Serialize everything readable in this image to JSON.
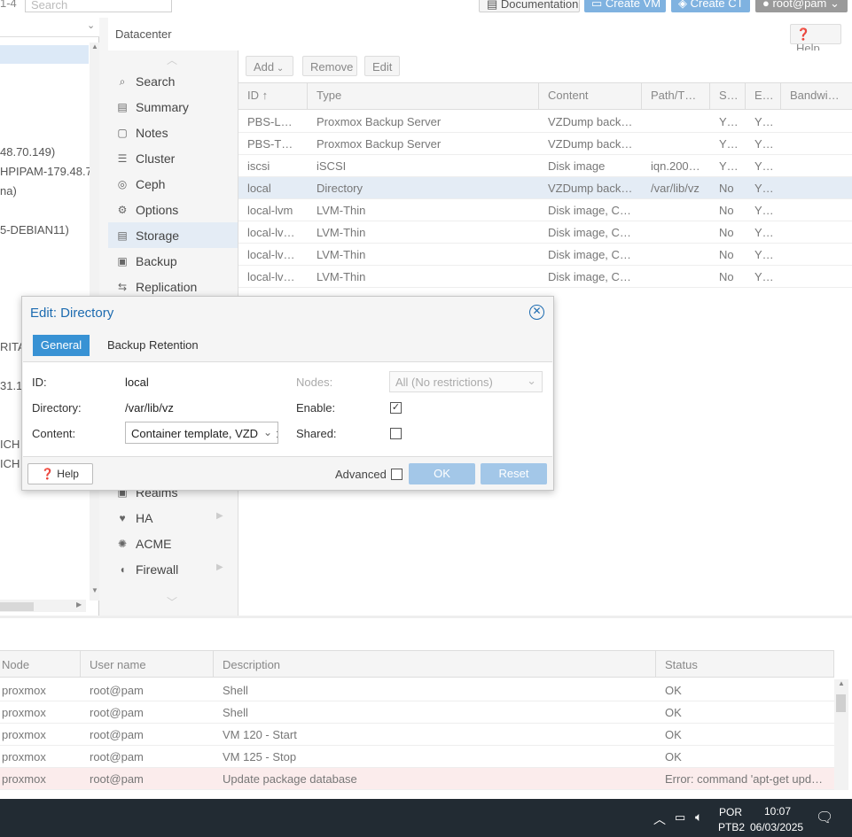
{
  "topbar": {
    "version": "1-4",
    "search_placeholder": "Search",
    "docs": "Documentation",
    "create_vm": "Create VM",
    "create_ct": "Create CT",
    "user": "root@pam"
  },
  "tree": {
    "fragments": [
      "48.70.149)",
      "HPIPAM-179.48.7",
      "na)",
      "5-DEBIAN11)",
      "RITA",
      "31.1",
      "ICH",
      "ICH"
    ]
  },
  "panel": {
    "title": "Datacenter",
    "help": "Help"
  },
  "menu": {
    "items": [
      {
        "icon": "search-icon",
        "glyph": "⌕",
        "label": "Search"
      },
      {
        "icon": "summary-icon",
        "glyph": "▤",
        "label": "Summary"
      },
      {
        "icon": "notes-icon",
        "glyph": "▢",
        "label": "Notes"
      },
      {
        "icon": "cluster-icon",
        "glyph": "☰",
        "label": "Cluster"
      },
      {
        "icon": "ceph-icon",
        "glyph": "◎",
        "label": "Ceph"
      },
      {
        "icon": "options-icon",
        "glyph": "⚙",
        "label": "Options"
      },
      {
        "icon": "storage-icon",
        "glyph": "▤",
        "label": "Storage"
      },
      {
        "icon": "backup-icon",
        "glyph": "▣",
        "label": "Backup"
      },
      {
        "icon": "replication-icon",
        "glyph": "⇆",
        "label": "Replication"
      }
    ],
    "lower": [
      {
        "icon": "realms-icon",
        "glyph": "▣",
        "label": "Realms"
      },
      {
        "icon": "ha-icon",
        "glyph": "♥",
        "label": "HA"
      },
      {
        "icon": "acme-icon",
        "glyph": "✺",
        "label": "ACME"
      },
      {
        "icon": "firewall-icon",
        "glyph": "◖",
        "label": "Firewall"
      }
    ]
  },
  "toolbar": {
    "add": "Add",
    "remove": "Remove",
    "edit": "Edit"
  },
  "storage_table": {
    "columns": [
      "ID ↑",
      "Type",
      "Content",
      "Path/T…",
      "S…",
      "E…",
      "Bandwi…"
    ],
    "rows": [
      [
        "PBS-L…",
        "Proxmox Backup Server",
        "VZDump back…",
        "",
        "Y…",
        "Y…"
      ],
      [
        "PBS-T…",
        "Proxmox Backup Server",
        "VZDump back…",
        "",
        "Y…",
        "Y…"
      ],
      [
        "iscsi",
        "iSCSI",
        "Disk image",
        "iqn.200…",
        "Y…",
        "Y…"
      ],
      [
        "local",
        "Directory",
        "VZDump back…",
        "/var/lib/vz",
        "No",
        "Y…"
      ],
      [
        "local-lvm",
        "LVM-Thin",
        "Disk image, C…",
        "",
        "No",
        "Y…"
      ],
      [
        "local-lv…",
        "LVM-Thin",
        "Disk image, C…",
        "",
        "No",
        "Y…"
      ],
      [
        "local-lv…",
        "LVM-Thin",
        "Disk image, C…",
        "",
        "No",
        "Y…"
      ],
      [
        "local-lv…",
        "LVM-Thin",
        "Disk image, C…",
        "",
        "No",
        "Y…"
      ]
    ]
  },
  "dialog": {
    "title": "Edit: Directory",
    "tabs": [
      "General",
      "Backup Retention"
    ],
    "id_label": "ID:",
    "id_value": "local",
    "dir_label": "Directory:",
    "dir_value": "/var/lib/vz",
    "content_label": "Content:",
    "content_value": "Container template, VZDump backup file",
    "nodes_label": "Nodes:",
    "nodes_value": "All (No restrictions)",
    "enable_label": "Enable:",
    "shared_label": "Shared:",
    "help": "Help",
    "advanced": "Advanced",
    "ok": "OK",
    "reset": "Reset"
  },
  "log": {
    "columns": [
      "Node",
      "User name",
      "Description",
      "Status"
    ],
    "rows": [
      [
        "proxmox",
        "root@pam",
        "Shell",
        "OK"
      ],
      [
        "proxmox",
        "root@pam",
        "Shell",
        "OK"
      ],
      [
        "proxmox",
        "root@pam",
        "VM 120 - Start",
        "OK"
      ],
      [
        "proxmox",
        "root@pam",
        "VM 125 - Stop",
        "OK"
      ],
      [
        "proxmox",
        "root@pam",
        "Update package database",
        "Error: command 'apt-get upd…"
      ]
    ]
  },
  "taskbar": {
    "lang1": "POR",
    "lang2": "PTB2",
    "time": "10:07",
    "date": "06/03/2025"
  }
}
